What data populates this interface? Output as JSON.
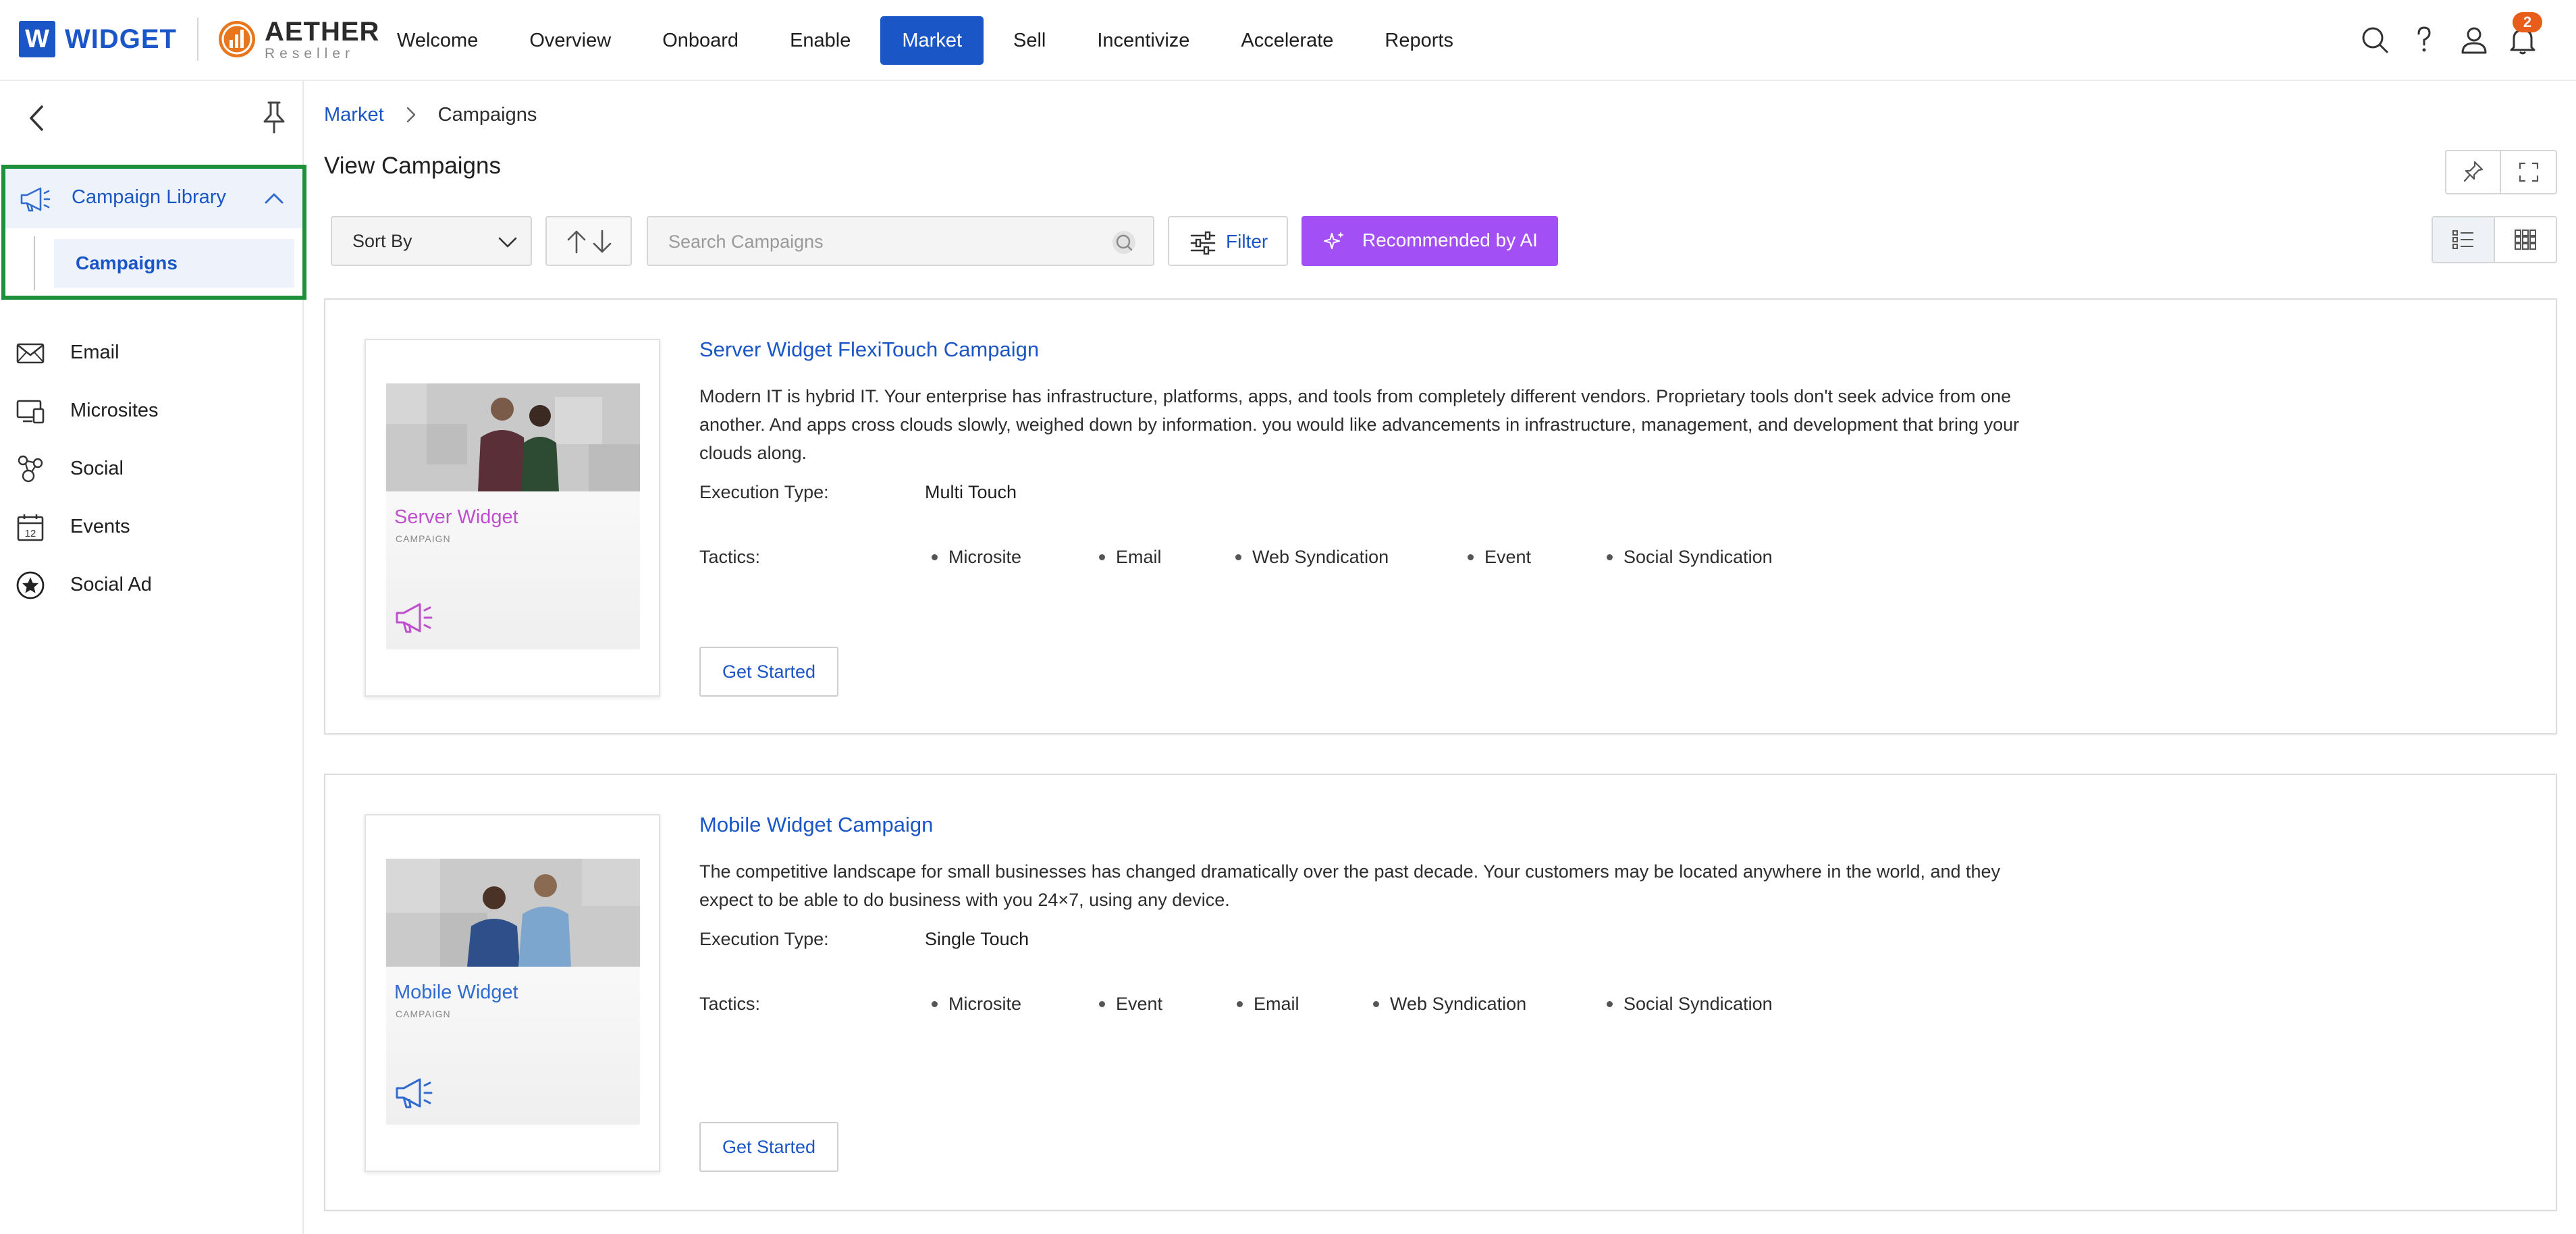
{
  "header": {
    "brand_letter": "W",
    "brand_name": "WIDGET",
    "partner_name": "AETHER",
    "partner_sub": "Reseller",
    "menu": [
      "Welcome",
      "Overview",
      "Onboard",
      "Enable",
      "Market",
      "Sell",
      "Incentivize",
      "Accelerate",
      "Reports"
    ],
    "active_menu": "Market",
    "notification_count": "2",
    "accent_color": "#1a56c6"
  },
  "sidebar": {
    "group_label": "Campaign Library",
    "group_child": "Campaigns",
    "items": [
      {
        "label": "Email",
        "icon": "envelope-icon"
      },
      {
        "label": "Microsites",
        "icon": "microsite-icon"
      },
      {
        "label": "Social",
        "icon": "social-icon"
      },
      {
        "label": "Events",
        "icon": "calendar-icon"
      },
      {
        "label": "Social Ad",
        "icon": "star-badge-icon"
      }
    ],
    "highlight_color": "#1e8f3a"
  },
  "breadcrumb": {
    "parent": "Market",
    "current": "Campaigns"
  },
  "page_title": "View Campaigns",
  "toolbar": {
    "sort_label": "Sort By",
    "search_placeholder": "Search Campaigns",
    "filter_label": "Filter",
    "ai_label": "Recommended by AI",
    "ai_color": "#a24ff5"
  },
  "labels": {
    "execution_type": "Execution Type:",
    "tactics": "Tactics:",
    "get_started": "Get Started",
    "thumb_sub": "CAMPAIGN"
  },
  "campaigns": [
    {
      "title": "Server Widget FlexiTouch Campaign",
      "description": "Modern IT is hybrid IT. Your enterprise has infrastructure, platforms, apps, and tools from completely different vendors. Proprietary tools don't seek advice from one another. And apps cross clouds slowly, weighed down by information. you would like advancements in infrastructure, management, and development that bring your clouds along.",
      "execution_type": "Multi Touch",
      "tactics": [
        "Microsite",
        "Email",
        "Web Syndication",
        "Event",
        "Social Syndication"
      ],
      "thumb_title": "Server Widget",
      "thumb_color": "#c04fd0"
    },
    {
      "title": "Mobile Widget Campaign",
      "description": "The competitive landscape for small businesses has changed dramatically over the past decade. Your customers may be located anywhere in the world, and they expect to be able to do business with you 24×7, using any device.",
      "execution_type": "Single Touch",
      "tactics": [
        "Microsite",
        "Event",
        "Email",
        "Web Syndication",
        "Social Syndication"
      ],
      "thumb_title": "Mobile Widget",
      "thumb_color": "#2f6bd0"
    }
  ]
}
